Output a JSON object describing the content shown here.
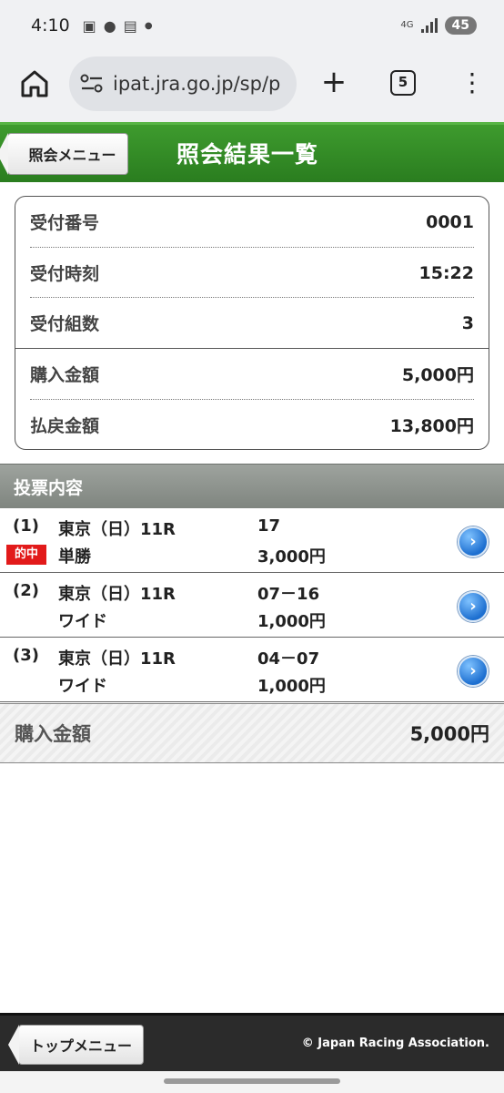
{
  "status_bar": {
    "time": "4:10",
    "network": "4G",
    "battery": "45"
  },
  "browser": {
    "url": "ipat.jra.go.jp/sp/p",
    "tab_count": "5",
    "plus": "+",
    "menu": "⋮"
  },
  "header": {
    "back_label": "照会メニュー",
    "title": "照会結果一覧"
  },
  "summary": {
    "rows": [
      {
        "label": "受付番号",
        "value": "0001"
      },
      {
        "label": "受付時刻",
        "value": "15:22"
      },
      {
        "label": "受付組数",
        "value": "3"
      },
      {
        "label": "購入金額",
        "value": "5,000円"
      },
      {
        "label": "払戻金額",
        "value": "13,800円"
      }
    ]
  },
  "section": {
    "title": "投票内容"
  },
  "bets": [
    {
      "index": "(1)",
      "race": "東京（日）11R",
      "type": "単勝",
      "combination": "17",
      "amount": "3,000円",
      "hit_label": "的中"
    },
    {
      "index": "(2)",
      "race": "東京（日）11R",
      "type": "ワイド",
      "combination": "07－16",
      "amount": "1,000円"
    },
    {
      "index": "(3)",
      "race": "東京（日）11R",
      "type": "ワイド",
      "combination": "04－07",
      "amount": "1,000円"
    }
  ],
  "total": {
    "label": "購入金額",
    "value": "5,000円"
  },
  "footer": {
    "top_menu_label": "トップメニュー",
    "copyright": "© Japan Racing Association."
  }
}
